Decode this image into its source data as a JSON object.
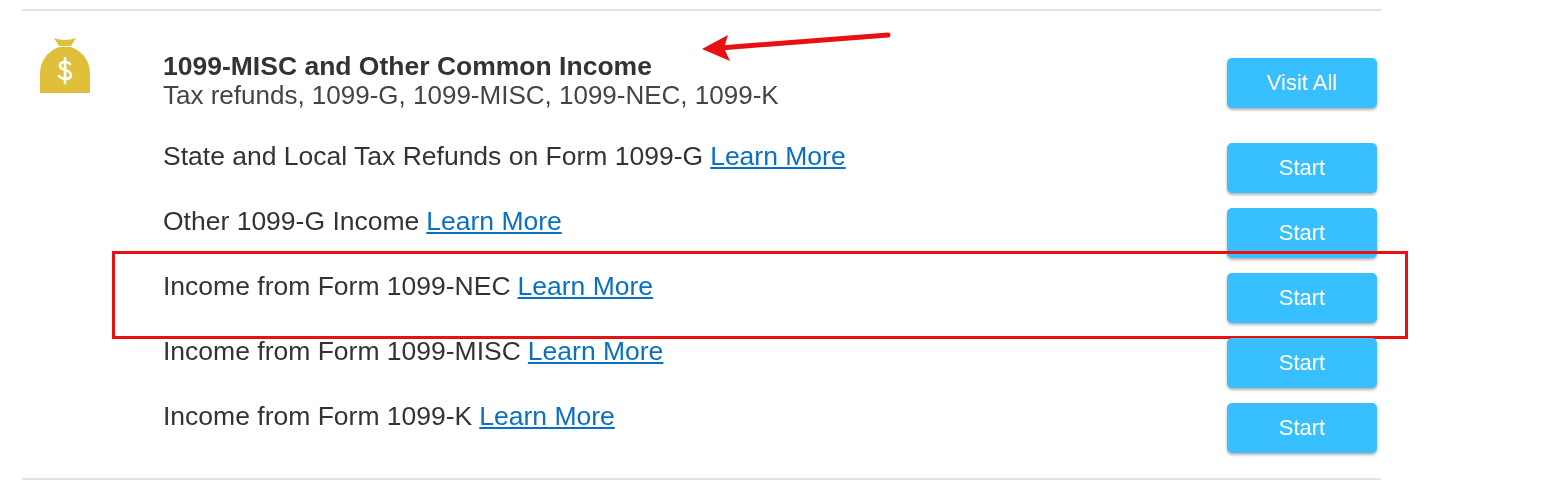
{
  "section": {
    "title": "1099-MISC and Other Common Income",
    "subtitle": "Tax refunds, 1099-G, 1099-MISC, 1099-NEC, 1099-K",
    "button": "Visit All"
  },
  "rows": [
    {
      "label": "State and Local Tax Refunds on Form 1099-G",
      "link": "Learn More",
      "button": "Start",
      "highlighted": false
    },
    {
      "label": "Other 1099-G Income",
      "link": "Learn More",
      "button": "Start",
      "highlighted": false
    },
    {
      "label": "Income from Form 1099-NEC",
      "link": "Learn More",
      "button": "Start",
      "highlighted": true
    },
    {
      "label": "Income from Form 1099-MISC",
      "link": "Learn More",
      "button": "Start",
      "highlighted": false
    },
    {
      "label": "Income from Form 1099-K",
      "link": "Learn More",
      "button": "Start",
      "highlighted": false
    }
  ],
  "arrow_annotation": true
}
